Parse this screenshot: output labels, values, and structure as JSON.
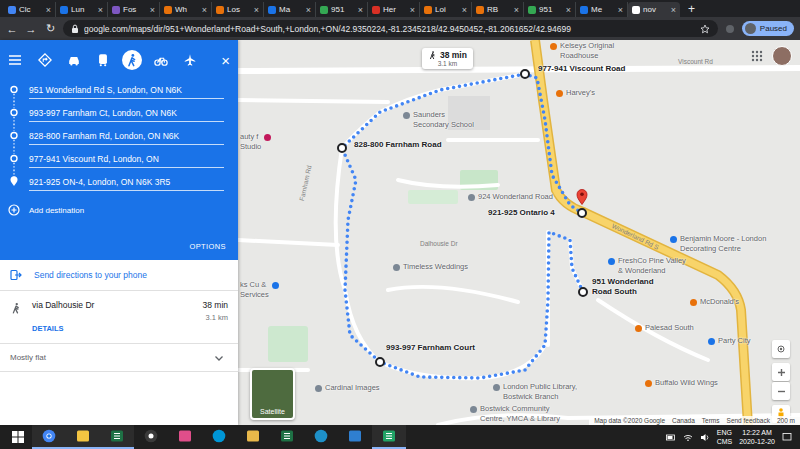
{
  "browser": {
    "tabs": [
      {
        "label": "Clc",
        "selected": false,
        "color": "#4285f4"
      },
      {
        "label": "Lun",
        "selected": false,
        "color": "#1a73e8"
      },
      {
        "label": "Fos",
        "selected": false,
        "color": "#7e57c2"
      },
      {
        "label": "Wh",
        "selected": false,
        "color": "#e8710a"
      },
      {
        "label": "Los",
        "selected": false,
        "color": "#e8710a"
      },
      {
        "label": "Ma",
        "selected": false,
        "color": "#1a73e8"
      },
      {
        "label": "951",
        "selected": false,
        "color": "#34a853"
      },
      {
        "label": "Her",
        "selected": false,
        "color": "#d93025"
      },
      {
        "label": "Loi",
        "selected": false,
        "color": "#e8710a"
      },
      {
        "label": "RB",
        "selected": false,
        "color": "#e8710a"
      },
      {
        "label": "951",
        "selected": false,
        "color": "#34a853"
      },
      {
        "label": "Me",
        "selected": false,
        "color": "#1a73e8"
      },
      {
        "label": "nov",
        "selected": true,
        "color": "#ffffff"
      }
    ],
    "close": "×",
    "new_tab": "+",
    "nav": [
      "←",
      "→",
      "↻"
    ],
    "url": "google.com/maps/dir/951+Wonderland+Road+South,+London,+ON/42.9350224,-81.2345218/42.9450452,-81.2061652/42.94699",
    "profile": "Paused"
  },
  "directions": {
    "modes": [
      {
        "kind": "best",
        "selected": false
      },
      {
        "kind": "car",
        "selected": false
      },
      {
        "kind": "transit",
        "selected": false
      },
      {
        "kind": "walk",
        "selected": true
      },
      {
        "kind": "bike",
        "selected": false
      },
      {
        "kind": "flight",
        "selected": false
      }
    ],
    "close": "×",
    "waypoints": [
      {
        "text": "951 Wonderland Rd S, London, ON N6K",
        "kind": "start"
      },
      {
        "text": "993-997 Farnham Ct, London, ON N6K",
        "kind": "stop"
      },
      {
        "text": "828-800 Farnham Rd, London, ON N6K",
        "kind": "stop"
      },
      {
        "text": "977-941 Viscount Rd, London, ON",
        "kind": "stop"
      },
      {
        "text": "921-925 ON-4, London, ON N6K 3R5",
        "kind": "end"
      }
    ],
    "add_destination": "Add destination",
    "options": "OPTIONS",
    "send": "Send directions to your phone",
    "route": {
      "via": "via Dalhousie Dr",
      "time": "38 min",
      "distance": "3.1 km",
      "details": "DETAILS"
    },
    "terrain": "Mostly flat"
  },
  "map": {
    "bubble": {
      "time": "38 min",
      "distance": "3.1 km"
    },
    "stops": [
      {
        "lines": [
          "951 Wonderland",
          "Road South"
        ],
        "kind": "start"
      },
      {
        "lines": [
          "993-997 Farnham Court"
        ],
        "kind": "stop"
      },
      {
        "lines": [
          "828-800 Farnham Road"
        ],
        "kind": "stop"
      },
      {
        "lines": [
          "977-941 Viscount Road"
        ],
        "kind": "stop"
      },
      {
        "lines": [
          "921-925 Ontario 4"
        ],
        "kind": "end"
      }
    ],
    "places": [
      {
        "lines": [
          "Kelseys Original",
          "Roadhouse"
        ],
        "color": "#e8710a",
        "kind": "poi"
      },
      {
        "lines": [
          "Harvey's"
        ],
        "color": "#e8710a",
        "kind": "poi"
      },
      {
        "lines": [
          "Saunders",
          "Secondary School"
        ],
        "color": "#7b8794",
        "kind": "poi"
      },
      {
        "lines": [
          "Timeless Weddings"
        ],
        "color": "#7b8794",
        "kind": "poi"
      },
      {
        "lines": [
          "FreshCo Pine Valley",
          "& Wonderland"
        ],
        "color": "#1a73e8",
        "kind": "poi"
      },
      {
        "lines": [
          "Benjamin Moore - London",
          "Decorating Centre"
        ],
        "color": "#1a73e8",
        "kind": "poi"
      },
      {
        "lines": [
          "McDonald's"
        ],
        "color": "#e8710a",
        "kind": "poi"
      },
      {
        "lines": [
          "Palesad South"
        ],
        "color": "#e8710a",
        "kind": "poi"
      },
      {
        "lines": [
          "Party City"
        ],
        "color": "#1a73e8",
        "kind": "poi"
      },
      {
        "lines": [
          "Buffalo Wild Wings"
        ],
        "color": "#e8710a",
        "kind": "poi"
      },
      {
        "lines": [
          "Cardinal Images"
        ],
        "color": "#7b8794",
        "kind": "poi"
      },
      {
        "lines": [
          "London Public Library,",
          "Bostwick Branch"
        ],
        "color": "#7b8794",
        "kind": "poi"
      },
      {
        "lines": [
          "Bostwick Community",
          "Centre, YMCA & Library"
        ],
        "color": "#7b8794",
        "kind": "poi"
      },
      {
        "lines": [
          "924 Wonderland Road"
        ],
        "color": "#7b8794",
        "kind": "poi"
      },
      {
        "lines": [
          "auty f",
          "Studio"
        ],
        "color": "#c2185b",
        "kind": "edge"
      },
      {
        "lines": [
          "ks Cu &",
          "Services"
        ],
        "color": "#1a73e8",
        "kind": "edge"
      }
    ],
    "streets": [
      "Viscount Rd",
      "Wonderland Rd S",
      "Dalhousie Dr",
      "Farnham Rd"
    ],
    "satellite": "Satellite",
    "footer": [
      "Map data ©2020 Google",
      "Canada",
      "Terms",
      "Send feedback",
      "200 m"
    ]
  },
  "taskbar": {
    "apps": [
      {
        "kind": "chrome",
        "open": true
      },
      {
        "kind": "explorer",
        "open": true
      },
      {
        "kind": "excel",
        "open": true
      },
      {
        "kind": "camera",
        "open": false
      },
      {
        "kind": "photos",
        "open": false
      },
      {
        "kind": "hp",
        "open": false
      },
      {
        "kind": "folder",
        "open": false
      },
      {
        "kind": "calc",
        "open": false
      },
      {
        "kind": "edge",
        "open": false
      },
      {
        "kind": "gallery",
        "open": false
      },
      {
        "kind": "sheet",
        "open": true
      }
    ],
    "language": [
      "ENG",
      "CMS"
    ],
    "time": "12:22 AM",
    "date": "2020-12-20"
  }
}
